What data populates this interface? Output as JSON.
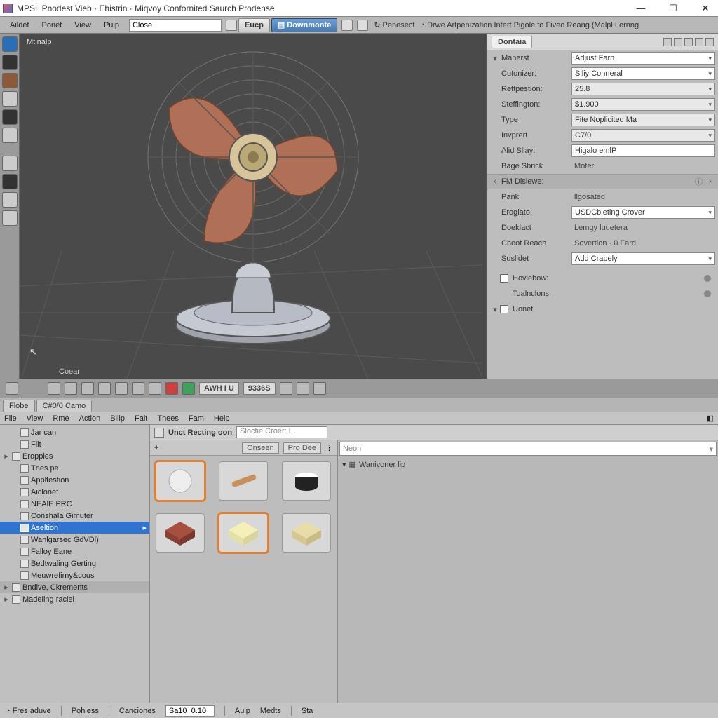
{
  "titlebar": {
    "title": "MPSL Pnodest Vieb · Ehistrin · Miqvoy Confornited Saurch Prodense"
  },
  "menubar": {
    "items": [
      "Aildet",
      "Poriet",
      "View",
      "Puip"
    ],
    "close_input": "Close",
    "btn_eucp": "Eucp",
    "btn_downmonte": "Downmonte",
    "label_penesect": "Penesect",
    "label_drive": "Drwe Artpenization Intert Pigole to Fiveo Reang (Malpl Lernng"
  },
  "viewport": {
    "label": "Mtinalp",
    "bottom_label": "Coear"
  },
  "props": {
    "tab": "Dontaia",
    "rows": [
      {
        "label": "Manerst",
        "value": "Adjust Farn",
        "type": "select",
        "chev": "▾"
      },
      {
        "label": "Cutonizer:",
        "value": "Slliy Conneral",
        "type": "select"
      },
      {
        "label": "Rettpestion:",
        "value": "25.8",
        "type": "select-light"
      },
      {
        "label": "Steffington:",
        "value": "$1.900",
        "type": "select-light"
      },
      {
        "label": "Type",
        "value": "Fite Noplicited Ma",
        "type": "select-light"
      },
      {
        "label": "Invprert",
        "value": "C7/0",
        "type": "select-light"
      },
      {
        "label": "Alid Sllay:",
        "value": "Higalo emlP",
        "type": "input"
      },
      {
        "label": "Bage Sbrick",
        "value": "Moter",
        "type": "text"
      }
    ],
    "section": "FM Dislewe:",
    "rows2": [
      {
        "label": "Pank",
        "value": "llgosated",
        "type": "text"
      },
      {
        "label": "Erogiato:",
        "value": "USDCbieting Crover",
        "type": "select"
      },
      {
        "label": "Doeklact",
        "value": "Lemgy luuetera",
        "type": "text"
      },
      {
        "label": "Cheot Reach",
        "value": "Sovertion · 0 Fard",
        "type": "text"
      },
      {
        "label": "Suslidet",
        "value": "Add Crapely",
        "type": "select"
      }
    ],
    "checks": [
      "Hoviebow:",
      "Toalnclons:"
    ],
    "check3": "Uonet"
  },
  "mid_toolbar": {
    "txt1": "AWH I U",
    "txt2": "9336S"
  },
  "bottom_tabs": [
    "Flobe",
    "C#0/0 Camo"
  ],
  "sub_menu": [
    "File",
    "View",
    "Rme",
    "Action",
    "Bllip",
    "Falt",
    "Thees",
    "Fam",
    "Help"
  ],
  "asset_toolbar": {
    "label": "Unct Recting oon",
    "search": "Sloctie Croer: L"
  },
  "asset_sub": {
    "btn1": "Onseen",
    "btn2": "Pro Dee"
  },
  "tree": [
    {
      "t": "",
      "lbl": "Jar can",
      "lvl": 1
    },
    {
      "t": "",
      "lbl": "Filt",
      "lvl": 1
    },
    {
      "t": "▸",
      "lbl": "Eropples",
      "lvl": 0
    },
    {
      "t": "",
      "lbl": "Tnes pe",
      "lvl": 1
    },
    {
      "t": "",
      "lbl": "Applfestion",
      "lvl": 1
    },
    {
      "t": "",
      "lbl": "Aiclonet",
      "lvl": 1
    },
    {
      "t": "",
      "lbl": "NEAlE PRC",
      "lvl": 1
    },
    {
      "t": "",
      "lbl": "Conshala Gimuter",
      "lvl": 1
    },
    {
      "t": "",
      "lbl": "Aseltion",
      "lvl": 1,
      "sel": true
    },
    {
      "t": "",
      "lbl": "Wanlgarsec GdVDl)",
      "lvl": 1
    },
    {
      "t": "",
      "lbl": "Falloy Eane",
      "lvl": 1
    },
    {
      "t": "",
      "lbl": "Bedtwaling Gerting",
      "lvl": 1
    },
    {
      "t": "",
      "lbl": "Meuwrefirny&cous",
      "lvl": 1
    },
    {
      "t": "▸",
      "lbl": "Bndive, Ckrements",
      "lvl": 0,
      "grey": true
    },
    {
      "t": "▸",
      "lbl": "Madeling raclel",
      "lvl": 0
    }
  ],
  "asset_right": {
    "search": "Neon",
    "detail": "Wanivoner lip"
  },
  "footer": {
    "items": [
      "Fres aduve",
      "Pohless",
      "Canciones"
    ],
    "input": "Sa10  0.10",
    "items2": [
      "Auip",
      "Medts",
      "Sta"
    ]
  }
}
